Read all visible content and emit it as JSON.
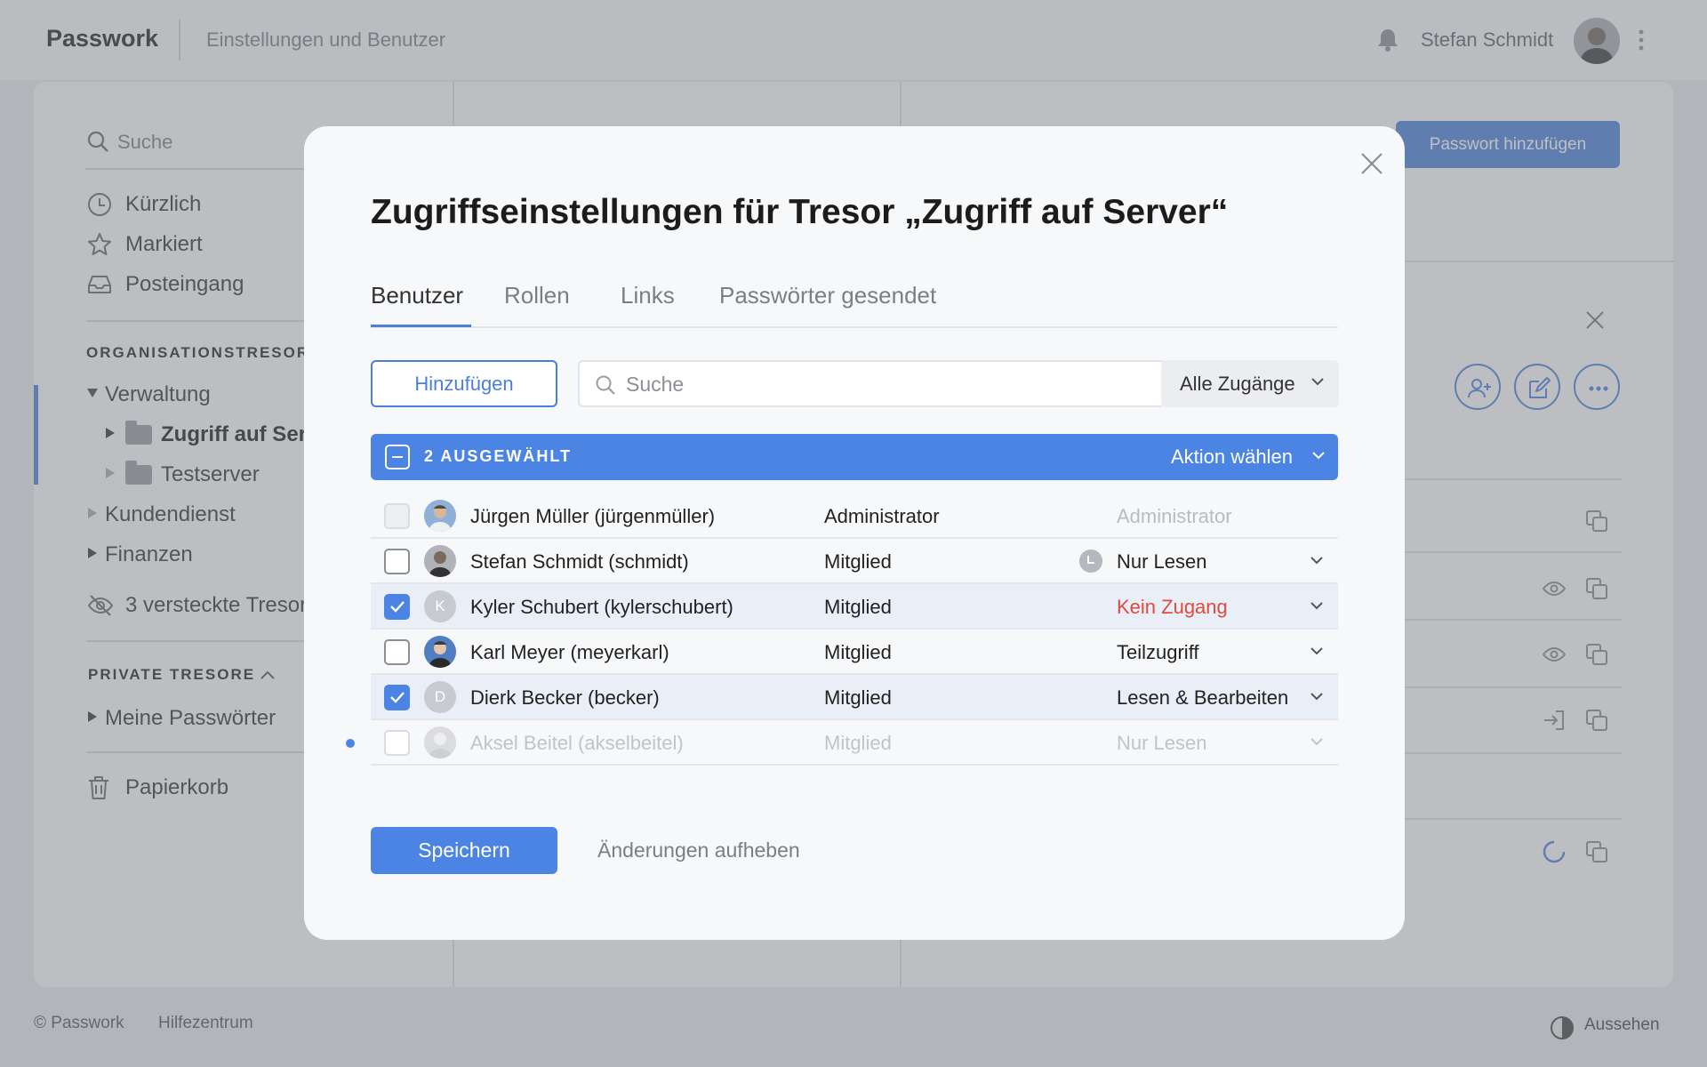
{
  "app": {
    "logo": "Passwork",
    "page_title": "Einstellungen und Benutzer",
    "user_name": "Stefan Schmidt"
  },
  "sidebar": {
    "search_placeholder": "Suche",
    "quick_links": [
      {
        "label": "Kürzlich",
        "icon": "clock-icon"
      },
      {
        "label": "Markiert",
        "icon": "star-icon"
      },
      {
        "label": "Posteingang",
        "icon": "inbox-icon"
      }
    ],
    "org_section_title": "ORGANISATIONSTRESOR",
    "org_tree": {
      "verwaltung": "Verwaltung",
      "zugriff": "Zugriff auf Ser",
      "testserver": "Testserver",
      "kundendienst": "Kundendienst",
      "finanzen": "Finanzen"
    },
    "hidden_vaults": "3 versteckte Tresor",
    "private_section_title": "PRIVATE TRESORE",
    "private_tree": {
      "meine": "Meine Passwörter"
    },
    "trash": "Papierkorb"
  },
  "main": {
    "add_password_button": "Passwort hinzufügen"
  },
  "footer": {
    "copyright": "© Passwork",
    "help": "Hilfezentrum",
    "appearance": "Aussehen"
  },
  "modal": {
    "title": "Zugriffseinstellungen für Tresor „Zugriff auf Server“",
    "tabs": [
      {
        "label": "Benutzer",
        "active": true
      },
      {
        "label": "Rollen",
        "active": false
      },
      {
        "label": "Links",
        "active": false
      },
      {
        "label": "Passwörter gesendet",
        "active": false
      }
    ],
    "add_button": "Hinzufügen",
    "search_placeholder": "Suche",
    "filter_value": "Alle Zugänge",
    "selection": {
      "count_label": "2 AUSGEWÄHLT",
      "action_label": "Aktion wählen"
    },
    "users": [
      {
        "name": "Jürgen Müller (jürgenmüller)",
        "role": "Administrator",
        "access": "Administrator",
        "checked": false,
        "avatar": "photo",
        "initial": ""
      },
      {
        "name": "Stefan Schmidt (schmidt)",
        "role": "Mitglied",
        "access": "Nur Lesen",
        "checked": false,
        "avatar": "photo",
        "initial": ""
      },
      {
        "name": "Kyler Schubert (kylerschubert)",
        "role": "Mitglied",
        "access": "Kein Zugang",
        "checked": true,
        "avatar": "initial",
        "initial": "K"
      },
      {
        "name": "Karl Meyer (meyerkarl)",
        "role": "Mitglied",
        "access": "Teilzugriff",
        "checked": false,
        "avatar": "photo",
        "initial": ""
      },
      {
        "name": "Dierk Becker (becker)",
        "role": "Mitglied",
        "access": "Lesen & Bearbeiten",
        "checked": true,
        "avatar": "initial",
        "initial": "D"
      },
      {
        "name": "Aksel Beitel (akselbeitel)",
        "role": "Mitglied",
        "access": "Nur Lesen",
        "checked": false,
        "avatar": "photo",
        "initial": ""
      }
    ],
    "save_button": "Speichern",
    "discard_link": "Änderungen aufheben"
  },
  "colors": {
    "accent": "#4b84e3",
    "danger": "#e04a3f",
    "muted": "#7a7f87"
  }
}
